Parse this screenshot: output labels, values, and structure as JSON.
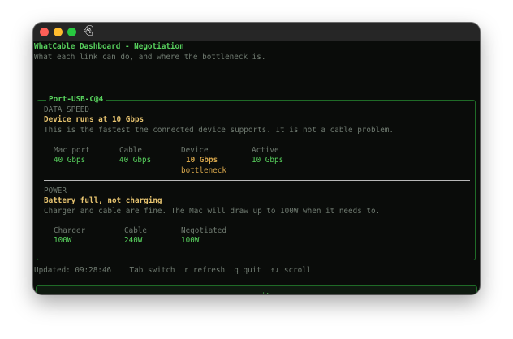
{
  "window": {
    "app_icon": "ghost-icon"
  },
  "header": {
    "title": "WhatCable Dashboard - Negotiation",
    "subtitle": "What each link can do, and where the bottleneck is."
  },
  "port": {
    "title": "Port-USB-C@4",
    "data_speed": {
      "section_label": "DATA SPEED",
      "headline": "Device runs at 10 Gbps",
      "description": "This is the fastest the connected device supports. It is not a cable problem.",
      "columns": [
        {
          "label": "Mac port",
          "value": "40 Gbps",
          "note": ""
        },
        {
          "label": "Cable",
          "value": "40 Gbps",
          "note": ""
        },
        {
          "label": "Device",
          "value": "10 Gbps",
          "note": "bottleneck"
        },
        {
          "label": "Active",
          "value": "10 Gbps",
          "note": ""
        }
      ]
    },
    "power": {
      "section_label": "POWER",
      "headline": "Battery full, not charging",
      "description": "Charger and cable are fine. The Mac will draw up to 100W when it needs to.",
      "columns": [
        {
          "label": "Charger",
          "value": "100W"
        },
        {
          "label": "Cable",
          "value": "240W"
        },
        {
          "label": "Negotiated",
          "value": "100W"
        }
      ]
    }
  },
  "status_line": "Updated: 09:28:46    Tab switch  r refresh  q quit  ↑↓ scroll",
  "footer": {
    "quit_key": "q",
    "quit_label": "quit"
  },
  "colors": {
    "accent": "#58d35e",
    "bottleneck": "#d7a64b",
    "border": "#1f6b27"
  }
}
